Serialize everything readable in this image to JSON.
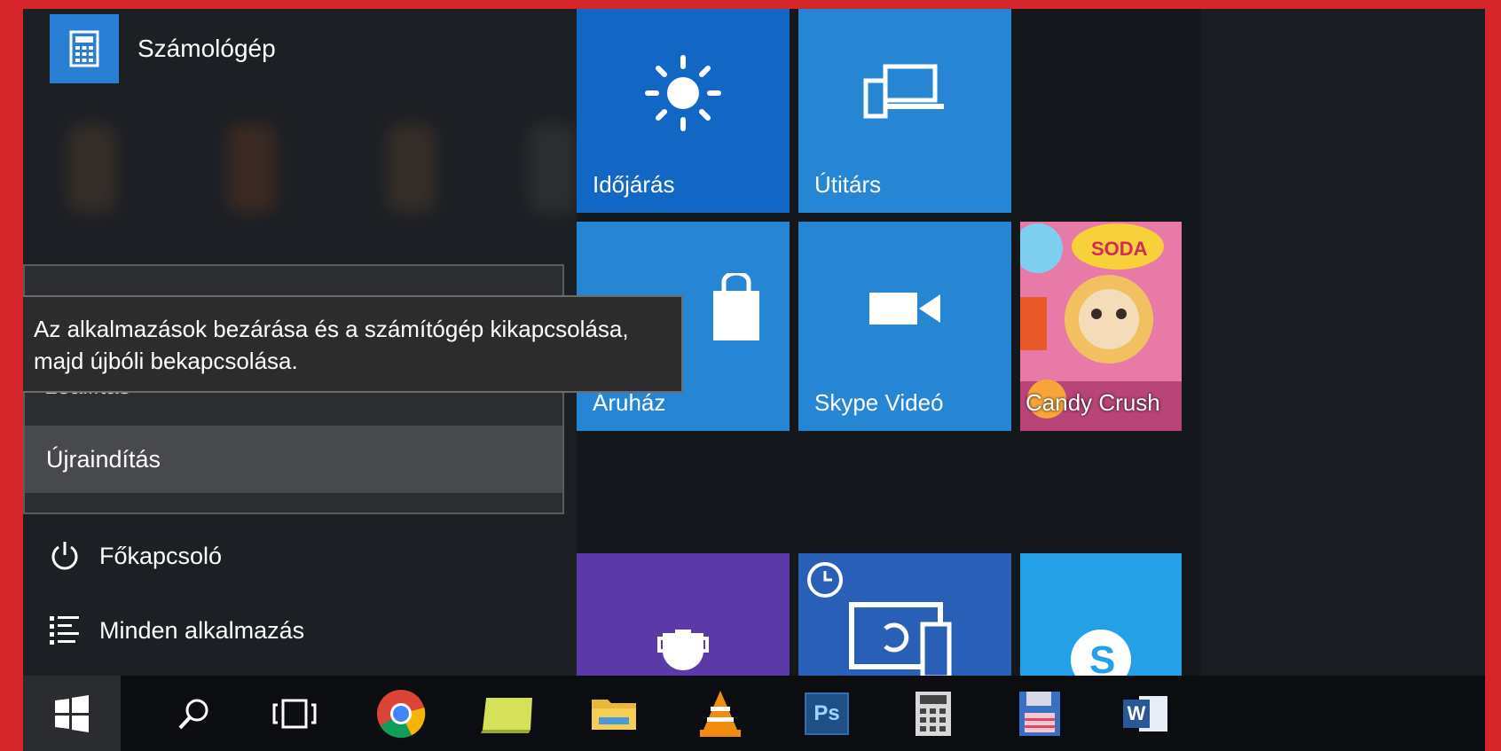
{
  "start_menu": {
    "recent_app": {
      "label": "Számológép",
      "icon": "calculator-icon"
    },
    "power_menu": {
      "hidden_item_label": "Leállítás",
      "restart_label": "Újraindítás"
    },
    "tooltip": {
      "line1": "Az alkalmazások bezárása és a számítógép kikapcsolása,",
      "line2": "majd újbóli bekapcsolása."
    },
    "power_button_label": "Főkapcsoló",
    "all_apps_label": "Minden alkalmazás"
  },
  "tiles": {
    "weather": {
      "label": "Időjárás",
      "icon": "sun-icon",
      "color": "#1266c4"
    },
    "companion": {
      "label": "Útitárs",
      "icon": "devices-icon",
      "color": "#2786d4"
    },
    "store": {
      "label": "Áruház",
      "icon": "shopping-bag-icon",
      "color": "#2786d4"
    },
    "skype_video": {
      "label": "Skype Videó",
      "icon": "video-camera-icon",
      "color": "#2786d4"
    },
    "candy_crush": {
      "label": "Candy Crush",
      "icon": "candy-icon"
    },
    "purple_tile": {
      "icon": "cup-icon",
      "color": "#5b3aa8"
    },
    "phone_companion": {
      "icon": "sync-devices-icon",
      "color": "#2a5fb8"
    },
    "skype": {
      "icon": "skype-icon",
      "color": "#24a0e6"
    }
  },
  "taskbar": {
    "items": [
      "start-icon",
      "search-icon",
      "task-view-icon",
      "chrome-icon",
      "sticky-notes-icon",
      "file-explorer-icon",
      "vlc-icon",
      "photoshop-icon",
      "calculator-icon",
      "save-floppy-icon",
      "word-icon"
    ],
    "photoshop_text": "Ps",
    "word_text": "W"
  }
}
